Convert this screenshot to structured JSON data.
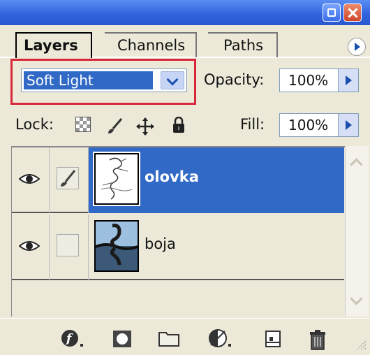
{
  "tabs": [
    {
      "label": "Layers",
      "active": true
    },
    {
      "label": "Channels",
      "active": false
    },
    {
      "label": "Paths",
      "active": false
    }
  ],
  "blend_mode": {
    "value": "Soft Light"
  },
  "opacity": {
    "label": "Opacity:",
    "value": "100%"
  },
  "lock": {
    "label": "Lock:",
    "icons": [
      "lock-transparent-pixels-icon",
      "lock-image-pixels-icon",
      "lock-position-icon",
      "lock-all-icon"
    ]
  },
  "fill": {
    "label": "Fill:",
    "value": "100%"
  },
  "layers": [
    {
      "name": "olovka",
      "visible": true,
      "selected": true,
      "linked_brush": true
    },
    {
      "name": "boja",
      "visible": true,
      "selected": false,
      "linked_brush": false
    }
  ],
  "bottom_icons": [
    "layer-style-icon",
    "layer-mask-icon",
    "new-group-icon",
    "adjustment-layer-icon",
    "new-layer-icon",
    "trash-icon"
  ],
  "colors": {
    "selection": "#3169c6",
    "panel": "#ece9d8",
    "highlight_box": "#d8263a"
  }
}
